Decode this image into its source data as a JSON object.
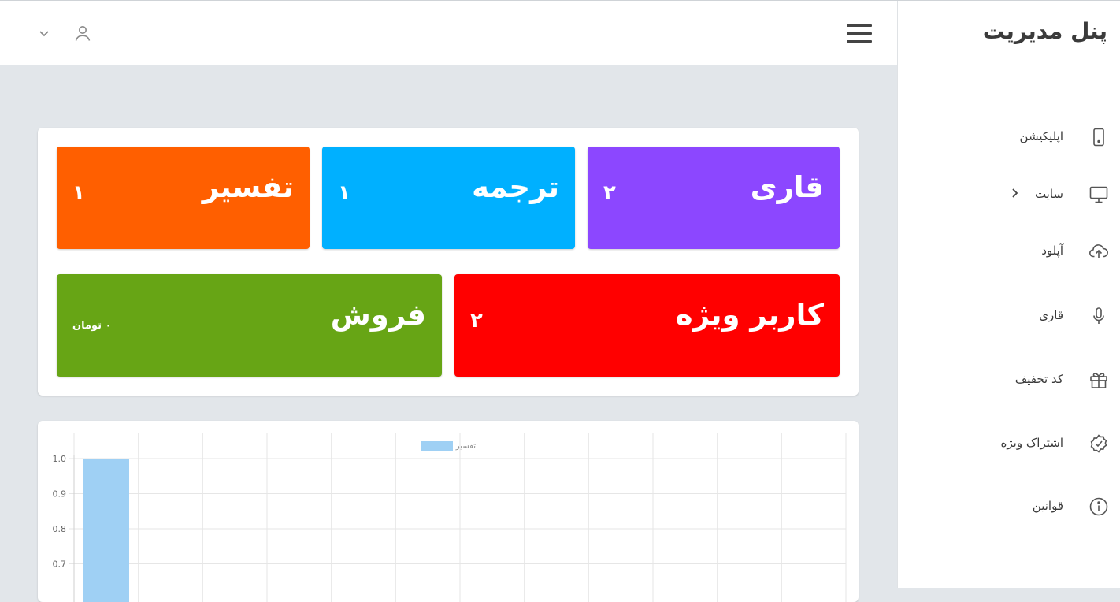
{
  "sidebar": {
    "brand": "پنل مدیریت",
    "items": [
      {
        "label": "اپلیکیشن",
        "icon": "mobile-icon"
      },
      {
        "label": "سایت",
        "icon": "monitor-icon",
        "has_submenu": true
      },
      {
        "label": "آپلود",
        "icon": "cloud-upload-icon"
      },
      {
        "label": "قاری",
        "icon": "microphone-icon"
      },
      {
        "label": "کد تخفیف",
        "icon": "gift-icon"
      },
      {
        "label": "اشتراک ویژه",
        "icon": "check-badge-icon"
      },
      {
        "label": "قوانین",
        "icon": "info-icon"
      }
    ]
  },
  "header": {
    "menu_icon": "hamburger-icon",
    "user_icon": "user-icon",
    "dropdown_icon": "chevron-down-icon"
  },
  "stats": {
    "tiles": [
      {
        "title": "قاری",
        "value": "۲",
        "color": "#8c47ff"
      },
      {
        "title": "ترجمه",
        "value": "۱",
        "color": "#00b0ff"
      },
      {
        "title": "تفسیر",
        "value": "۱",
        "color": "#ff5f00"
      },
      {
        "title": "کاربر ویژه",
        "value": "۲",
        "color": "#ff0000"
      },
      {
        "title": "فروش",
        "value": "۰ تومان",
        "color": "#67a515"
      }
    ]
  },
  "chart_data": {
    "type": "bar",
    "series": [
      {
        "name": "تفسیر",
        "values": [
          1.0
        ],
        "color": "#9fd0f4"
      }
    ],
    "yticks": [
      "1.0",
      "0.9",
      "0.8",
      "0.7"
    ],
    "ylim": [
      0.6,
      1.0
    ],
    "grid": true,
    "legend": "top-center"
  }
}
